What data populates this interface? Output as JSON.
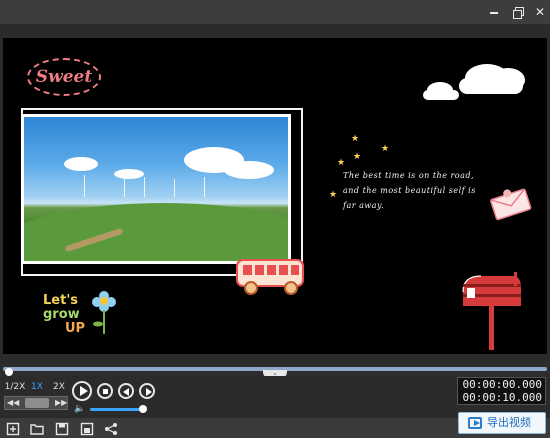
{
  "window": {
    "controls": {
      "minimize": "minimize",
      "maximize": "restore",
      "close": "✕"
    }
  },
  "preview": {
    "badge_text": "Sweet",
    "quote_lines": [
      "The best time is on the road,",
      "and the most beautiful self is",
      "far away."
    ],
    "sticker_text": [
      "Let's",
      "grow",
      "UP"
    ]
  },
  "timeline": {
    "progress": 0.0,
    "collapse_glyph": "⌄"
  },
  "playback": {
    "speeds": [
      "1/2X",
      "1X",
      "2X"
    ],
    "active_speed": "1X",
    "volume_fraction": 1.0,
    "current_time": "00:00:00.000",
    "total_time": "00:00:10.000"
  },
  "bottom_toolbar": {
    "tools": [
      "new-project-icon",
      "open-folder-icon",
      "save-icon",
      "save-as-icon",
      "share-icon"
    ],
    "export_label": "导出视频"
  },
  "colors": {
    "accent": "#3aa3ff",
    "badge": "#f07c84",
    "export_text": "#1f6fbf"
  }
}
